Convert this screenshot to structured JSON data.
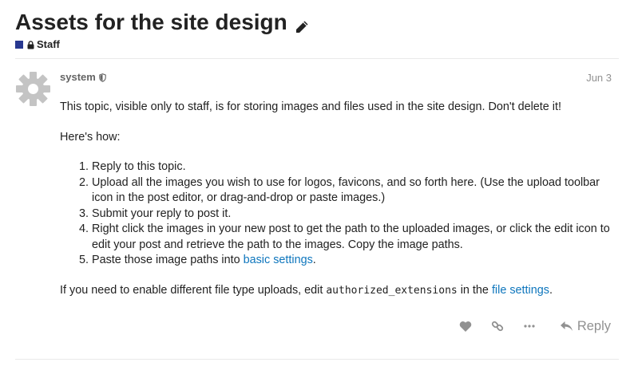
{
  "topic": {
    "title": "Assets for the site design",
    "category": {
      "name": "Staff",
      "color": "#283890"
    }
  },
  "post": {
    "username": "system",
    "date": "Jun 3",
    "intro": "This topic, visible only to staff, is for storing images and files used in the site design. Don't delete it!",
    "howto_heading": "Here's how:",
    "steps": [
      "Reply to this topic.",
      "Upload all the images you wish to use for logos, favicons, and so forth here. (Use the upload toolbar icon in the post editor, or drag-and-drop or paste images.)",
      "Submit your reply to post it.",
      "Right click the images in your new post to get the path to the uploaded images, or click the edit icon to edit your post and retrieve the path to the images. Copy the image paths.",
      "Paste those image paths into "
    ],
    "step5_link": "basic settings",
    "step5_suffix": ".",
    "footer_prefix": "If you need to enable different file type uploads, edit ",
    "footer_code": "authorized_extensions",
    "footer_middle": " in the ",
    "footer_link": "file settings",
    "footer_suffix": "."
  },
  "actions": {
    "like_icon": "heart-icon",
    "link_icon": "link-icon",
    "more_icon": "ellipsis-icon",
    "reply_label": "Reply"
  },
  "colors": {
    "link": "#0e76bd",
    "muted": "#919191",
    "avatar": "#c4c4c4"
  }
}
